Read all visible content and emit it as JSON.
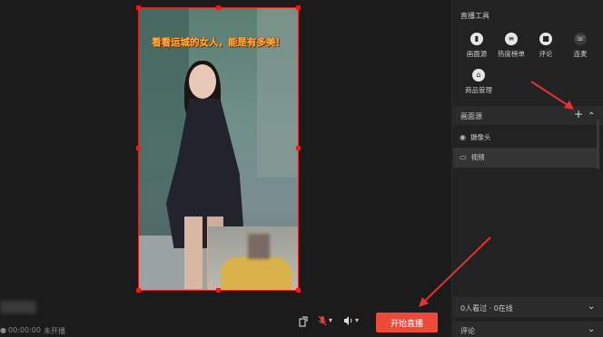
{
  "preview": {
    "caption": "看看运城的女人，能是有多美！"
  },
  "status": {
    "time": "00:00:00",
    "state": "未开播"
  },
  "controls": {
    "start_label": "开始直播",
    "mic_caret": "▾",
    "vol_caret": "▾"
  },
  "live_tools": {
    "title": "直播工具",
    "items": [
      {
        "label": "画面源",
        "icon": "screen-icon"
      },
      {
        "label": "热度榜单",
        "icon": "list-icon"
      },
      {
        "label": "评论",
        "icon": "comment-icon"
      },
      {
        "label": "连麦",
        "icon": "phone-icon"
      },
      {
        "label": "商品管理",
        "icon": "shop-icon"
      }
    ]
  },
  "sources": {
    "title": "画面源",
    "add": "+",
    "collapse": "⌃",
    "items": [
      {
        "label": "摄像头",
        "icon": "camera-icon"
      },
      {
        "label": "视频",
        "icon": "video-icon"
      }
    ]
  },
  "viewers": {
    "text": "0人看过 · 0在线",
    "chevron": "⌄"
  },
  "comments": {
    "title": "评论",
    "chevron": "⌄"
  },
  "colors": {
    "accent": "#ee4a3a",
    "selection_border": "#e02020",
    "caption": "#ffb23f"
  }
}
